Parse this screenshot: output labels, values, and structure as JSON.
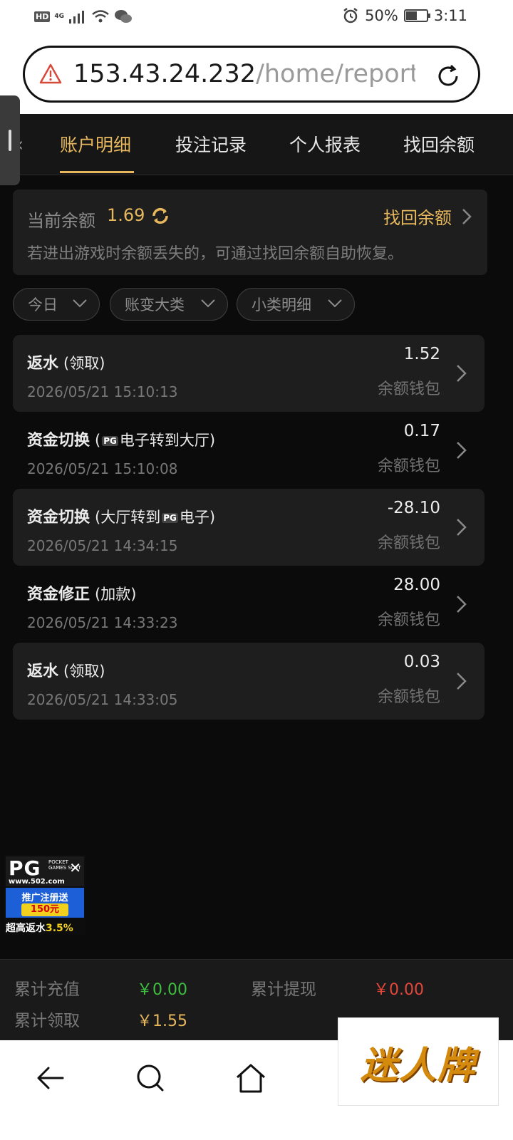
{
  "status_bar": {
    "hd": "HD",
    "network": "4G",
    "battery": "50%",
    "battery_level": 0.5,
    "time": "3:11"
  },
  "browser": {
    "url_host": "153.43.24.232",
    "url_path": "/home/report?c"
  },
  "tabs": [
    {
      "label": "账户明细",
      "active": true
    },
    {
      "label": "投注记录",
      "active": false
    },
    {
      "label": "个人报表",
      "active": false
    },
    {
      "label": "找回余额",
      "active": false
    }
  ],
  "balance": {
    "label": "当前余额",
    "value": "1.69",
    "recover_label": "找回余额",
    "hint": "若进出游戏时余额丢失的，可通过找回余额自助恢复。"
  },
  "filters": [
    {
      "label": "今日"
    },
    {
      "label": "账变大类"
    },
    {
      "label": "小类明细"
    }
  ],
  "records": [
    {
      "type": "返水",
      "sub": "(领取)",
      "time": "2026/05/21 15:10:13",
      "amount": "1.52",
      "wallet": "余额钱包"
    },
    {
      "type": "资金切换",
      "sub_pre": "(",
      "sub_logo": "PG",
      "sub_post": "电子转到大厅)",
      "time": "2026/05/21 15:10:08",
      "amount": "0.17",
      "wallet": "余额钱包"
    },
    {
      "type": "资金切换",
      "sub_pre": "(大厅转到",
      "sub_logo": "PG",
      "sub_post": "电子)",
      "time": "2026/05/21 14:34:15",
      "amount": "-28.10",
      "wallet": "余额钱包"
    },
    {
      "type": "资金修正",
      "sub": "(加款)",
      "time": "2026/05/21 14:33:23",
      "amount": "28.00",
      "wallet": "余额钱包"
    },
    {
      "type": "返水",
      "sub": "(领取)",
      "time": "2026/05/21 14:33:05",
      "amount": "0.03",
      "wallet": "余额钱包"
    }
  ],
  "ad": {
    "logo": "PG",
    "logo_sub": "POCKET GAMES SOFT",
    "site": "www.502.com",
    "promo": "推广注册送",
    "amount": "150元",
    "rebate_prefix": "超高返水",
    "rebate_value": "3.5%"
  },
  "summary": {
    "recharge_label": "累计充值",
    "recharge_value": "￥0.00",
    "withdraw_label": "累计提现",
    "withdraw_value": "￥0.00",
    "claim_label": "累计领取",
    "claim_value": "￥1.55"
  },
  "watermark": "迷人牌",
  "colors": {
    "accent": "#e6b75c",
    "recharge": "#3fbf3f",
    "withdraw": "#e5463a",
    "claim": "#e6b75c"
  }
}
